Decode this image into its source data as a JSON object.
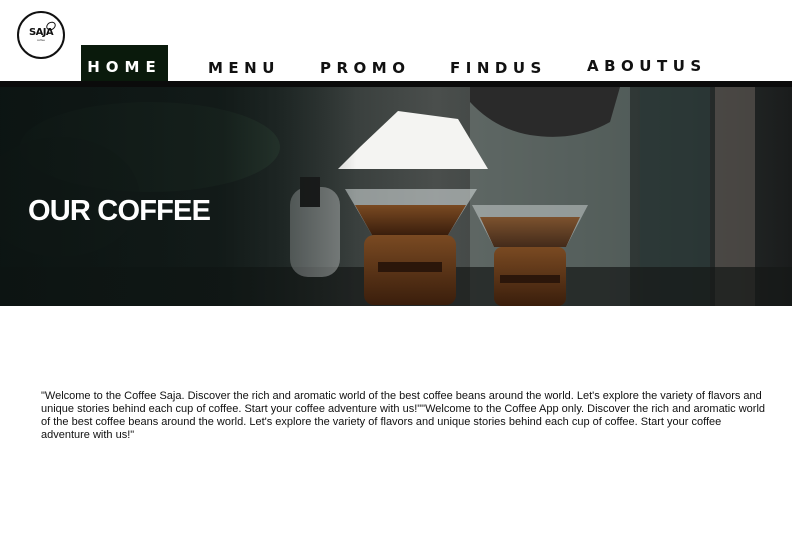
{
  "logo": {
    "text": "SAJA",
    "subtext": "coffee"
  },
  "nav": {
    "items": [
      {
        "label": "HOME",
        "active": true
      },
      {
        "label": "MENU"
      },
      {
        "label": "PROMO"
      },
      {
        "label": "FINDUS"
      },
      {
        "label": "ABOUTUS"
      }
    ]
  },
  "hero": {
    "title": "OUR COFFEE",
    "image": "coffee-pour-over-bar-photo"
  },
  "content": {
    "welcome": "\"Welcome to the Coffee Saja. Discover the rich and aromatic world of the best coffee beans around the world. Let's explore the variety of flavors and unique stories behind each cup of coffee. Start your coffee adventure with us!\"\"Welcome to the Coffee App only. Discover the rich and aromatic world of the best coffee beans around the world. Let's explore the variety of flavors and unique stories behind each cup of coffee. Start your coffee adventure with us!\""
  },
  "colors": {
    "nav_active_bg": "#0a1a0c",
    "nav_underline": "#0b0b0b",
    "text": "#111111"
  }
}
